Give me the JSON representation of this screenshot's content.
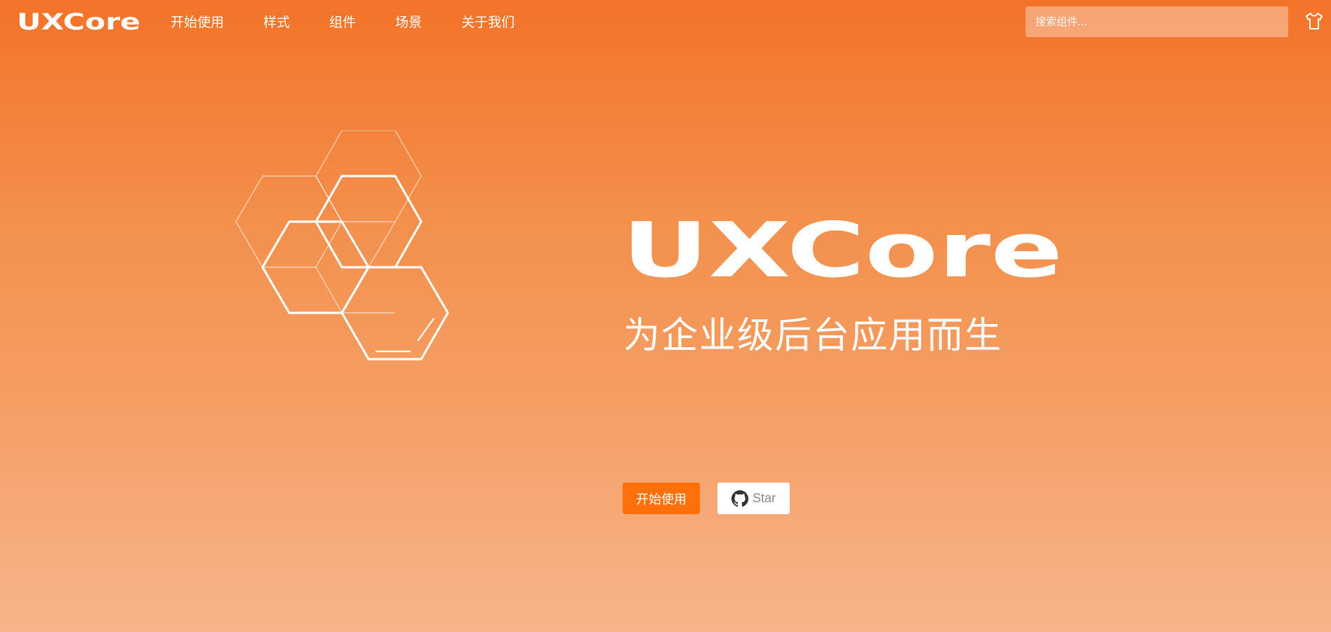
{
  "brand": {
    "logo_text": "UXCore"
  },
  "nav": {
    "items": [
      {
        "label": "开始使用"
      },
      {
        "label": "样式"
      },
      {
        "label": "组件"
      },
      {
        "label": "场景"
      },
      {
        "label": "关于我们"
      }
    ]
  },
  "search": {
    "placeholder": "搜索组件..."
  },
  "hero": {
    "title": "UXCore",
    "tagline": "为企业级后台应用而生",
    "primary_button": "开始使用",
    "star_button": "Star"
  },
  "icons": {
    "theme": "tshirt-icon",
    "github": "github-icon",
    "hexagons": "hexagon-illustration"
  },
  "colors": {
    "brand_orange": "#ff6f0a",
    "gradient_top": "#f37328",
    "gradient_bottom": "#f8b48a"
  }
}
